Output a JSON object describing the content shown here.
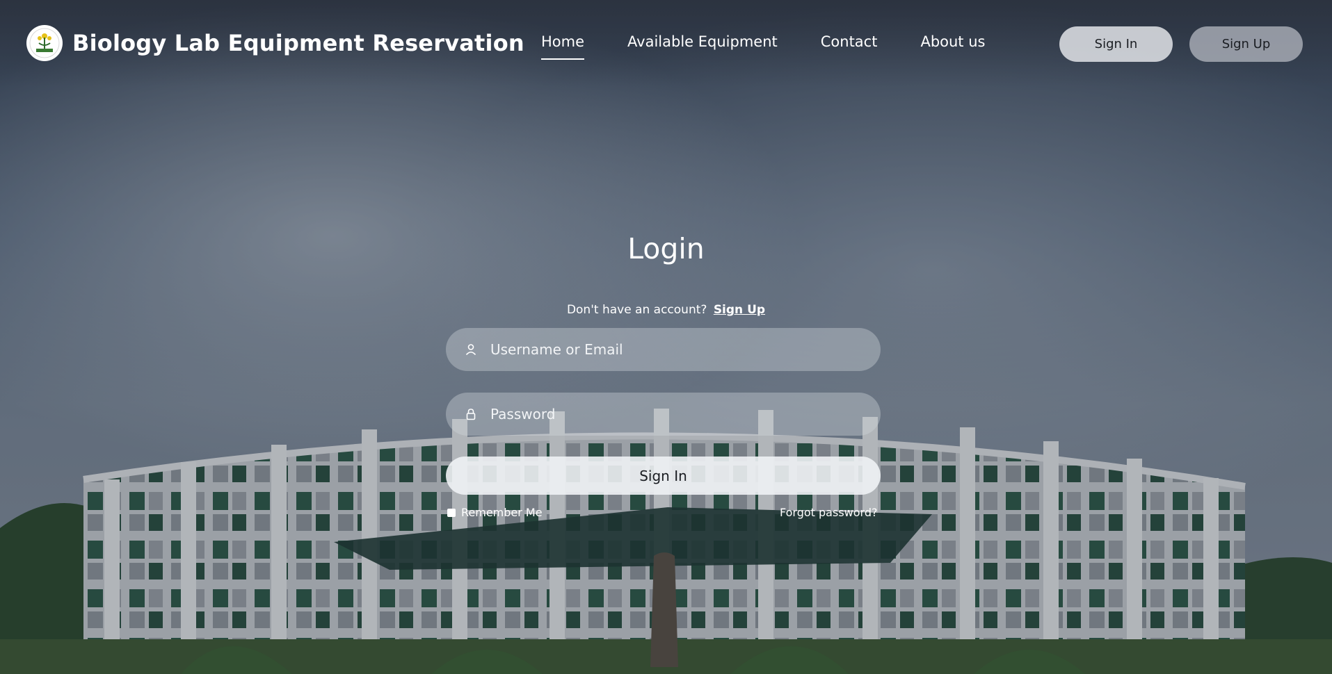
{
  "header": {
    "title": "Biology Lab Equipment Reservation",
    "logo_icon": "university-seal-logo",
    "nav": [
      {
        "label": "Home",
        "active": true
      },
      {
        "label": "Available Equipment",
        "active": false
      },
      {
        "label": "Contact",
        "active": false
      },
      {
        "label": "About us",
        "active": false
      }
    ],
    "signin_label": "Sign In",
    "signup_label": "Sign Up"
  },
  "login": {
    "title": "Login",
    "account_prompt": "Don't have an account?",
    "signup_link": "Sign Up",
    "username_placeholder": "Username or Email",
    "username_icon": "user-icon",
    "password_placeholder": "Password",
    "password_icon": "lock-icon",
    "submit_label": "Sign In",
    "remember_label": "Remember Me",
    "remember_checked": false,
    "forgot_label": "Forgot password?"
  },
  "background": {
    "subject": "campus-building-photo"
  }
}
